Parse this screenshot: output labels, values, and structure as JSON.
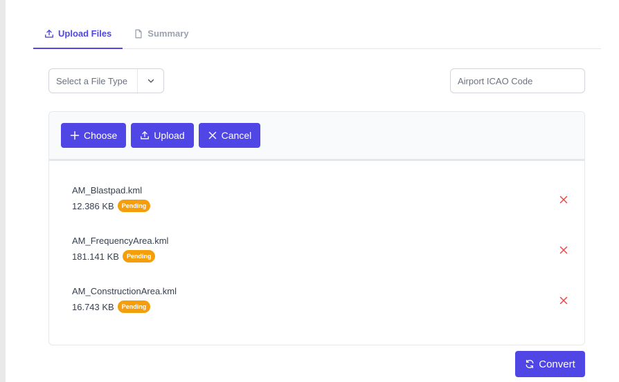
{
  "tabs": [
    {
      "label": "Upload Files",
      "icon": "upload-icon",
      "active": true
    },
    {
      "label": "Summary",
      "icon": "file-icon",
      "active": false
    }
  ],
  "file_type_select": {
    "placeholder": "Select a File Type"
  },
  "icao_input": {
    "placeholder": "Airport ICAO Code",
    "value": ""
  },
  "toolbar": {
    "choose_label": "Choose",
    "upload_label": "Upload",
    "cancel_label": "Cancel"
  },
  "files": [
    {
      "name": "AM_Blastpad.kml",
      "size": "12.386 KB",
      "status": "Pending"
    },
    {
      "name": "AM_FrequencyArea.kml",
      "size": "181.141 KB",
      "status": "Pending"
    },
    {
      "name": "AM_ConstructionArea.kml",
      "size": "16.743 KB",
      "status": "Pending"
    }
  ],
  "convert_label": "Convert",
  "colors": {
    "accent": "#4f46e5",
    "pending": "#f59e0b",
    "remove": "#ef4444"
  }
}
